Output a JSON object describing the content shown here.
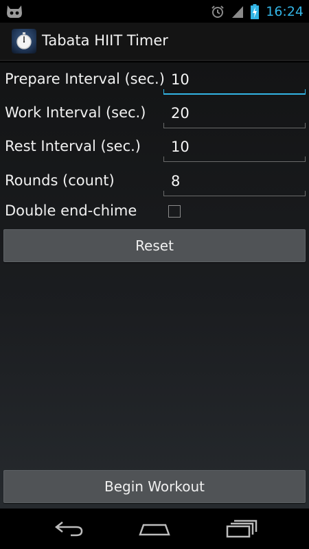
{
  "status_bar": {
    "time": "16:24",
    "icons": [
      "cyanogenmod-mascot-icon",
      "alarm-icon",
      "signal-icon",
      "battery-charging-icon"
    ],
    "accent_color": "#33b5e5"
  },
  "action_bar": {
    "title": "Tabata HIIT Timer",
    "icon": "stopwatch-icon"
  },
  "settings": {
    "prepare": {
      "label": "Prepare Interval (sec.)",
      "value": "10"
    },
    "work": {
      "label": "Work Interval (sec.)",
      "value": "20"
    },
    "rest": {
      "label": "Rest Interval (sec.)",
      "value": "10"
    },
    "rounds": {
      "label": "Rounds (count)",
      "value": "8"
    },
    "double_chime": {
      "label": "Double end-chime",
      "checked": false
    }
  },
  "buttons": {
    "reset": "Reset",
    "begin": "Begin Workout"
  },
  "nav_bar": {
    "icons": [
      "back-icon",
      "home-icon",
      "recent-apps-icon"
    ]
  }
}
